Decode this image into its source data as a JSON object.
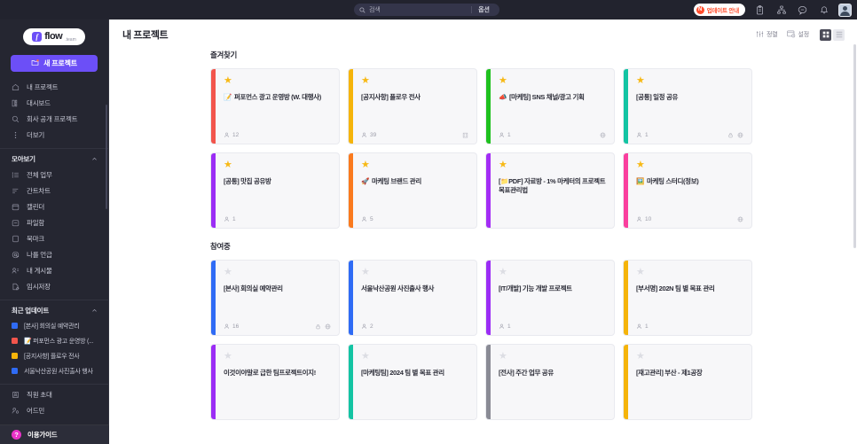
{
  "topbar": {
    "search": {
      "placeholder": "검색",
      "icon": "search-icon",
      "options_label": "옵션"
    },
    "update_badge": {
      "icon_letter": "N",
      "label": "업데이트 안내"
    },
    "icons": [
      "clipboard-icon",
      "org-chart-icon",
      "chat-icon",
      "bell-icon"
    ],
    "avatar": "user-avatar"
  },
  "sidebar": {
    "logo": {
      "mark": "f",
      "word": "flow",
      "sub": ".team"
    },
    "new_project_button": {
      "label": "새 프로젝트",
      "icon": "folder-plus-icon",
      "color": "#6c4ff7"
    },
    "nav_items": [
      {
        "label": "내 프로젝트",
        "icon": "home-icon"
      },
      {
        "label": "대시보드",
        "icon": "dashboard-icon"
      },
      {
        "label": "회사 공개 프로젝트",
        "icon": "search-icon"
      },
      {
        "label": "더보기",
        "icon": "more-vertical-icon"
      }
    ],
    "collect_group": {
      "label": "모아보기",
      "chevron": "chevron-up-icon"
    },
    "collect_items": [
      {
        "label": "전체 업무",
        "icon": "list-icon"
      },
      {
        "label": "간트차트",
        "icon": "gantt-icon"
      },
      {
        "label": "캘린더",
        "icon": "calendar-icon"
      },
      {
        "label": "파일함",
        "icon": "file-box-icon"
      },
      {
        "label": "북마크",
        "icon": "bookmark-icon"
      },
      {
        "label": "나를 언급",
        "icon": "mention-icon"
      },
      {
        "label": "내 게시물",
        "icon": "my-posts-icon"
      },
      {
        "label": "임시저장",
        "icon": "draft-icon"
      }
    ],
    "recent_group": {
      "label": "최근 업데이트",
      "chevron": "chevron-up-icon"
    },
    "recent_items": [
      {
        "label": "[본사] 회의실 예약관리",
        "color": "#2f6bf5"
      },
      {
        "label": "📝 퍼포먼스 광고 운영방 (...",
        "color": "#f2554c"
      },
      {
        "label": "[공지사항] 플로우 전사",
        "color": "#f5b40a"
      },
      {
        "label": "서울낙산공원 사진출사 행사",
        "color": "#2f6bf5"
      }
    ],
    "bottom_items": [
      {
        "label": "직원 초대",
        "icon": "invite-user-icon"
      },
      {
        "label": "어드민",
        "icon": "admin-icon"
      }
    ],
    "guide": {
      "label": "이용가이드",
      "icon": "question-mark-icon",
      "color": "#e832c8"
    }
  },
  "main": {
    "page_title": "내 프로젝트",
    "tools": [
      {
        "label": "정렬",
        "icon": "sort-icon"
      },
      {
        "label": "설정",
        "icon": "settings-board-icon"
      }
    ],
    "view_toggle": [
      {
        "icon": "grid-view-icon",
        "active": true
      },
      {
        "icon": "list-view-icon",
        "active": false
      }
    ],
    "sections": [
      {
        "title": "즐겨찾기",
        "cards": [
          {
            "title": "퍼포먼스 광고 운영방 (W. 대행사)",
            "emoji": "📝",
            "accent": "#f2554c",
            "starred": true,
            "members": "12",
            "icons": []
          },
          {
            "title": "[공지사항] 플로우 전사",
            "emoji": "",
            "accent": "#f5b40a",
            "starred": true,
            "members": "39",
            "icons": [
              "company-icon"
            ]
          },
          {
            "title": "[마케팅] SNS 채널/광고 기획",
            "emoji": "📣",
            "accent": "#1fc11f",
            "starred": true,
            "members": "1",
            "icons": [
              "globe-icon"
            ]
          },
          {
            "title": "[공통] 일정 공유",
            "emoji": "",
            "accent": "#13c4a3",
            "starred": true,
            "members": "1",
            "icons": [
              "lock-icon",
              "globe-icon"
            ]
          },
          {
            "title": "[공통] 맛집 공유방",
            "emoji": "",
            "accent": "#9b2df5",
            "starred": true,
            "members": "1",
            "icons": []
          },
          {
            "title": "마케팅 브랜드 관리",
            "emoji": "🚀",
            "accent": "#fa7a1e",
            "starred": true,
            "members": "5",
            "icons": []
          },
          {
            "title": "[📁PDF] 자료방 - 1% 마케터의 프로젝트 목표관리법",
            "emoji": "",
            "accent": "#a32df5",
            "starred": true,
            "members": "",
            "icons": []
          },
          {
            "title": "마케팅 스터디(정보)",
            "emoji": "🖼️",
            "accent": "#fa3f9e",
            "starred": true,
            "members": "10",
            "icons": [
              "globe-icon"
            ]
          }
        ]
      },
      {
        "title": "참여중",
        "cards": [
          {
            "title": "[본사] 회의실 예약관리",
            "emoji": "",
            "accent": "#2f6bf5",
            "starred": false,
            "members": "16",
            "icons": [
              "lock-icon",
              "globe-icon"
            ]
          },
          {
            "title": "서울낙산공원 사진출사 행사",
            "emoji": "",
            "accent": "#2f6bf5",
            "starred": false,
            "members": "2",
            "icons": []
          },
          {
            "title": "[IT/개발] 기능 개발 프로젝트",
            "emoji": "",
            "accent": "#9b2df5",
            "starred": false,
            "members": "1",
            "icons": []
          },
          {
            "title": "[부서명] 202N 팀 별 목표 관리",
            "emoji": "",
            "accent": "#f5b40a",
            "starred": false,
            "members": "1",
            "icons": []
          },
          {
            "title": "이것이야말로 급한 팀프로젝트이지!",
            "emoji": "",
            "accent": "#9b2df5",
            "starred": false,
            "members": "",
            "icons": []
          },
          {
            "title": "[마케팅팀] 2024 팀 별 목표 관리",
            "emoji": "",
            "accent": "#13c4a3",
            "starred": false,
            "members": "",
            "icons": []
          },
          {
            "title": "[전사] 주간 업무 공유",
            "emoji": "",
            "accent": "#8a8b95",
            "starred": false,
            "members": "",
            "icons": []
          },
          {
            "title": "[재고관리] 부산 - 제1공장",
            "emoji": "",
            "accent": "#f5b40a",
            "starred": false,
            "members": "",
            "icons": []
          }
        ]
      }
    ]
  }
}
